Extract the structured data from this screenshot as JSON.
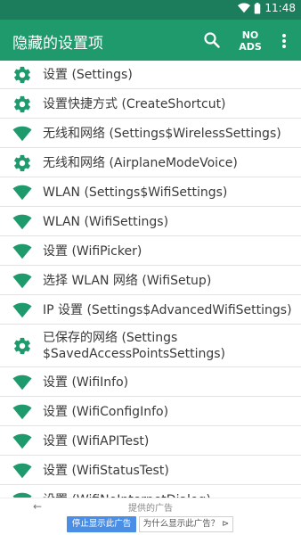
{
  "status_bar": {
    "time": "11:48"
  },
  "app_bar": {
    "title": "隐藏的设置项",
    "no_ads_line1": "NO",
    "no_ads_line2": "ADS"
  },
  "list": [
    {
      "icon": "gear-icon",
      "label": "设置 (Settings)"
    },
    {
      "icon": "gear-icon",
      "label": "设置快捷方式 (CreateShortcut)"
    },
    {
      "icon": "wifi-icon",
      "label": "无线和网络 (Settings$WirelessSettings)"
    },
    {
      "icon": "gear-icon",
      "label": "无线和网络 (AirplaneModeVoice)"
    },
    {
      "icon": "wifi-icon",
      "label": "WLAN (Settings$WifiSettings)"
    },
    {
      "icon": "wifi-icon",
      "label": "WLAN (WifiSettings)"
    },
    {
      "icon": "wifi-icon",
      "label": "设置 (WifiPicker)"
    },
    {
      "icon": "wifi-icon",
      "label": "选择 WLAN 网络 (WifiSetup)"
    },
    {
      "icon": "wifi-icon",
      "label": "IP 设置 (Settings$AdvancedWifiSettings)"
    },
    {
      "icon": "gear-icon",
      "label": "已保存的网络 (Settings $SavedAccessPointsSettings)"
    },
    {
      "icon": "wifi-icon",
      "label": "设置 (WifiInfo)"
    },
    {
      "icon": "wifi-icon",
      "label": "设置 (WifiConfigInfo)"
    },
    {
      "icon": "wifi-icon",
      "label": "设置 (WifiAPITest)"
    },
    {
      "icon": "wifi-icon",
      "label": "设置 (WifiStatusTest)"
    },
    {
      "icon": "wifi-icon",
      "label": "设置 (WifiNoInternetDialog)"
    }
  ],
  "ad": {
    "provided_label": "提供的广告",
    "stop_label": "停止显示此广告",
    "why_label": "为什么显示此广告？ ⊳"
  },
  "colors": {
    "primary": "#1f9a6c",
    "status": "#1b7d5b",
    "icon": "#1f9a6c",
    "ad_button": "#4a8ee6"
  }
}
